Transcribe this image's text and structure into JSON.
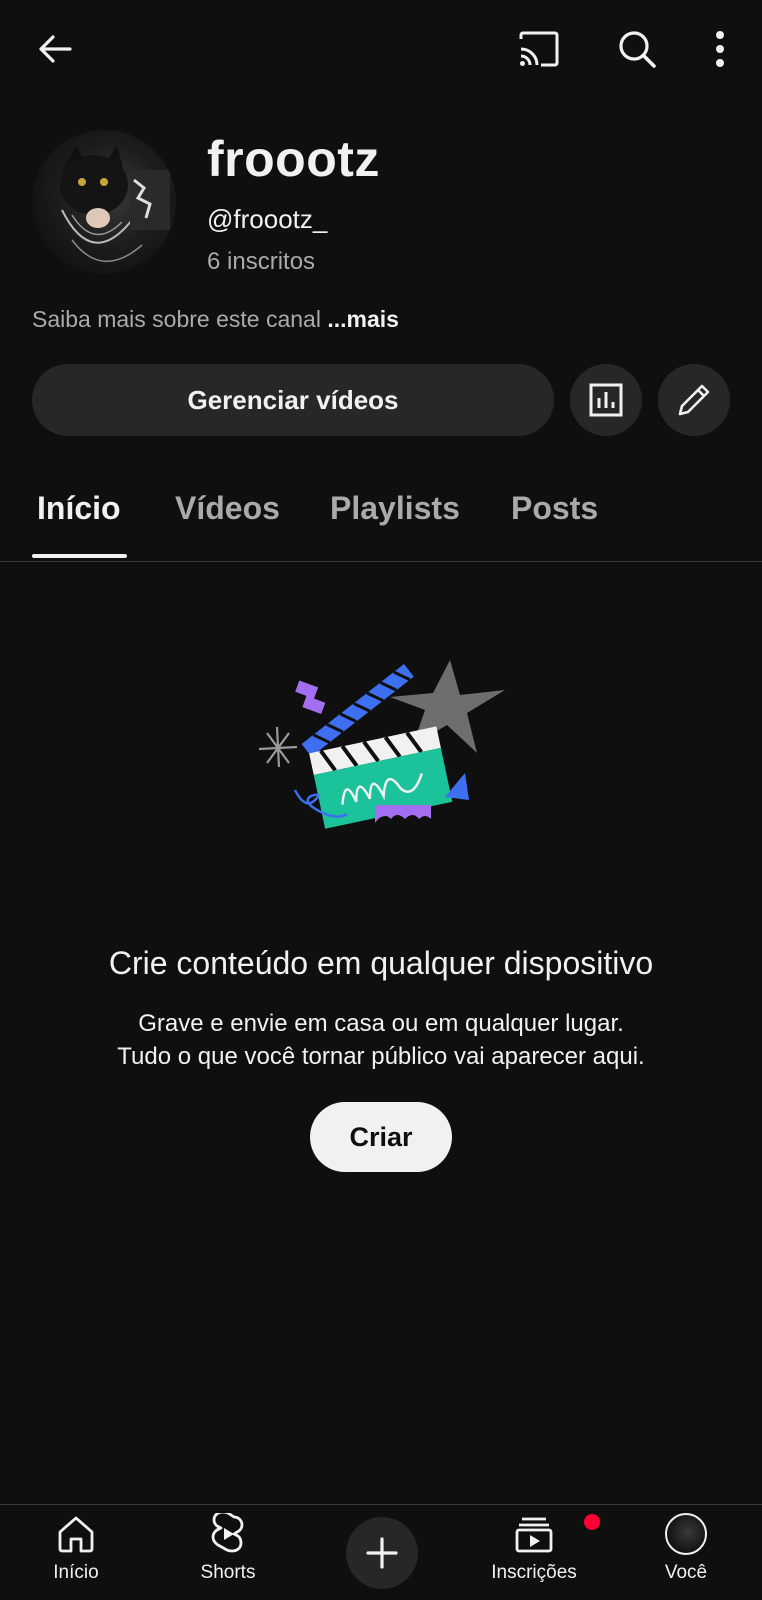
{
  "topbar": {
    "back_icon": "arrow-left-icon",
    "cast_icon": "cast-icon",
    "search_icon": "search-icon",
    "more_icon": "more-vert-icon"
  },
  "channel": {
    "name": "froootz",
    "handle": "@froootz_",
    "subscribers": "6 inscritos",
    "about_text": "Saiba mais sobre este canal",
    "about_more": "...mais"
  },
  "actions": {
    "manage_label": "Gerenciar vídeos",
    "stats_icon": "analytics-icon",
    "edit_icon": "pencil-icon"
  },
  "tabs": [
    {
      "label": "Início",
      "selected": true
    },
    {
      "label": "Vídeos",
      "selected": false
    },
    {
      "label": "Playlists",
      "selected": false
    },
    {
      "label": "Posts",
      "selected": false
    }
  ],
  "empty_state": {
    "title": "Crie conteúdo em qualquer dispositivo",
    "line1": "Grave e envie em casa ou em qualquer lugar.",
    "line2": "Tudo o que você tornar público vai aparecer aqui.",
    "create_label": "Criar"
  },
  "bottom_nav": {
    "home": "Início",
    "shorts": "Shorts",
    "create_icon": "plus-icon",
    "subscriptions": "Inscrições",
    "you": "Você"
  },
  "colors": {
    "background": "#0f0f0f",
    "surface": "#272727",
    "text": "#f1f1f1",
    "muted": "#aaaaaa",
    "notification": "#ff0033"
  }
}
